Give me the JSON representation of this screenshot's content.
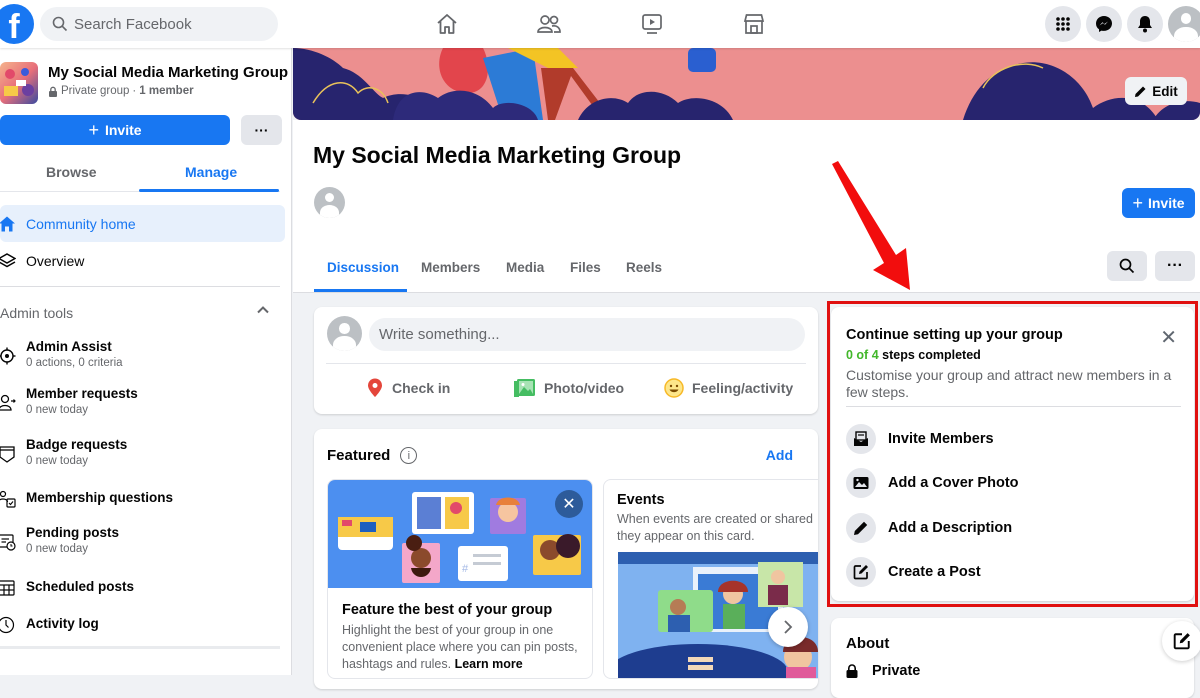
{
  "topbar": {
    "search_placeholder": "Search Facebook",
    "nav_icons": [
      "home-icon",
      "friends-icon",
      "watch-icon",
      "marketplace-icon"
    ],
    "right_icons": [
      "menu-grid-icon",
      "messenger-icon",
      "notifications-icon",
      "profile-avatar"
    ]
  },
  "sidebar": {
    "group_name": "My Social Media Marketing Group",
    "privacy": "Private group",
    "separator": "·",
    "members": "1 member",
    "invite_label": "Invite",
    "more_label": "···",
    "tabs": [
      {
        "label": "Browse",
        "active": false
      },
      {
        "label": "Manage",
        "active": true
      }
    ],
    "nav": [
      {
        "label": "Community home",
        "icon": "home-icon",
        "active": true
      },
      {
        "label": "Overview",
        "icon": "layers-icon",
        "active": false
      }
    ],
    "admin_tools_label": "Admin tools",
    "admin_items": [
      {
        "title": "Admin Assist",
        "subtitle": "0 actions, 0 criteria",
        "icon": "gear-icon"
      },
      {
        "title": "Member requests",
        "subtitle": "0 new today",
        "icon": "person-request-icon"
      },
      {
        "title": "Badge requests",
        "subtitle": "0 new today",
        "icon": "badge-icon"
      },
      {
        "title": "Membership questions",
        "subtitle": "",
        "icon": "questions-icon"
      },
      {
        "title": "Pending posts",
        "subtitle": "0 new today",
        "icon": "pending-posts-icon"
      },
      {
        "title": "Scheduled posts",
        "subtitle": "",
        "icon": "calendar-icon"
      },
      {
        "title": "Activity log",
        "subtitle": "",
        "icon": "clock-icon"
      }
    ]
  },
  "cover": {
    "edit_label": "Edit"
  },
  "group_header": {
    "title": "My Social Media Marketing Group",
    "invite_label": "Invite",
    "tabs": [
      {
        "label": "Discussion",
        "active": true
      },
      {
        "label": "Members",
        "active": false
      },
      {
        "label": "Media",
        "active": false
      },
      {
        "label": "Files",
        "active": false
      },
      {
        "label": "Reels",
        "active": false
      }
    ],
    "more_label": "···"
  },
  "composer": {
    "placeholder": "Write something...",
    "actions": [
      {
        "label": "Check in",
        "icon": "location-pin-icon",
        "color": "#e4463b"
      },
      {
        "label": "Photo/video",
        "icon": "photo-icon",
        "color": "#45bd62"
      },
      {
        "label": "Feeling/activity",
        "icon": "smiley-icon",
        "color": "#f7b928"
      }
    ]
  },
  "featured": {
    "title": "Featured",
    "add_label": "Add",
    "card1": {
      "heading": "Feature the best of your group",
      "body": "Highlight the best of your group in one convenient place where you can pin posts, hashtags and rules.",
      "link": "Learn more"
    },
    "card2": {
      "heading": "Events",
      "line1": "When events are created or shared",
      "line2": "they appear on this card."
    }
  },
  "setup": {
    "title": "Continue setting up your group",
    "steps_done": "0 of 4",
    "steps_suffix": "steps completed",
    "description": "Customise your group and attract new members in a few steps.",
    "steps": [
      {
        "label": "Invite Members",
        "icon": "invite-envelope-icon"
      },
      {
        "label": "Add a Cover Photo",
        "icon": "image-icon"
      },
      {
        "label": "Add a Description",
        "icon": "pencil-icon"
      },
      {
        "label": "Create a Post",
        "icon": "compose-icon"
      }
    ],
    "highlight_color": "#e01010"
  },
  "about": {
    "title": "About",
    "privacy": "Private"
  },
  "colors": {
    "brand": "#1877f2",
    "success": "#42b72a",
    "annotation": "#e01010"
  }
}
